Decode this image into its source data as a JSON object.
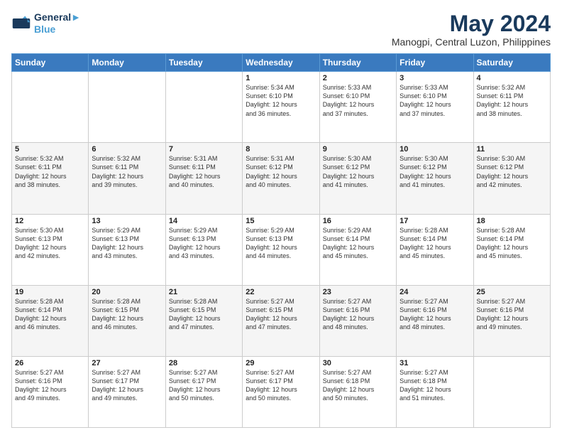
{
  "logo": {
    "line1": "General",
    "line2": "Blue"
  },
  "title": "May 2024",
  "subtitle": "Manogpi, Central Luzon, Philippines",
  "days_header": [
    "Sunday",
    "Monday",
    "Tuesday",
    "Wednesday",
    "Thursday",
    "Friday",
    "Saturday"
  ],
  "weeks": [
    [
      {
        "day": "",
        "text": ""
      },
      {
        "day": "",
        "text": ""
      },
      {
        "day": "",
        "text": ""
      },
      {
        "day": "1",
        "text": "Sunrise: 5:34 AM\nSunset: 6:10 PM\nDaylight: 12 hours\nand 36 minutes."
      },
      {
        "day": "2",
        "text": "Sunrise: 5:33 AM\nSunset: 6:10 PM\nDaylight: 12 hours\nand 37 minutes."
      },
      {
        "day": "3",
        "text": "Sunrise: 5:33 AM\nSunset: 6:10 PM\nDaylight: 12 hours\nand 37 minutes."
      },
      {
        "day": "4",
        "text": "Sunrise: 5:32 AM\nSunset: 6:11 PM\nDaylight: 12 hours\nand 38 minutes."
      }
    ],
    [
      {
        "day": "5",
        "text": "Sunrise: 5:32 AM\nSunset: 6:11 PM\nDaylight: 12 hours\nand 38 minutes."
      },
      {
        "day": "6",
        "text": "Sunrise: 5:32 AM\nSunset: 6:11 PM\nDaylight: 12 hours\nand 39 minutes."
      },
      {
        "day": "7",
        "text": "Sunrise: 5:31 AM\nSunset: 6:11 PM\nDaylight: 12 hours\nand 40 minutes."
      },
      {
        "day": "8",
        "text": "Sunrise: 5:31 AM\nSunset: 6:12 PM\nDaylight: 12 hours\nand 40 minutes."
      },
      {
        "day": "9",
        "text": "Sunrise: 5:30 AM\nSunset: 6:12 PM\nDaylight: 12 hours\nand 41 minutes."
      },
      {
        "day": "10",
        "text": "Sunrise: 5:30 AM\nSunset: 6:12 PM\nDaylight: 12 hours\nand 41 minutes."
      },
      {
        "day": "11",
        "text": "Sunrise: 5:30 AM\nSunset: 6:12 PM\nDaylight: 12 hours\nand 42 minutes."
      }
    ],
    [
      {
        "day": "12",
        "text": "Sunrise: 5:30 AM\nSunset: 6:13 PM\nDaylight: 12 hours\nand 42 minutes."
      },
      {
        "day": "13",
        "text": "Sunrise: 5:29 AM\nSunset: 6:13 PM\nDaylight: 12 hours\nand 43 minutes."
      },
      {
        "day": "14",
        "text": "Sunrise: 5:29 AM\nSunset: 6:13 PM\nDaylight: 12 hours\nand 43 minutes."
      },
      {
        "day": "15",
        "text": "Sunrise: 5:29 AM\nSunset: 6:13 PM\nDaylight: 12 hours\nand 44 minutes."
      },
      {
        "day": "16",
        "text": "Sunrise: 5:29 AM\nSunset: 6:14 PM\nDaylight: 12 hours\nand 45 minutes."
      },
      {
        "day": "17",
        "text": "Sunrise: 5:28 AM\nSunset: 6:14 PM\nDaylight: 12 hours\nand 45 minutes."
      },
      {
        "day": "18",
        "text": "Sunrise: 5:28 AM\nSunset: 6:14 PM\nDaylight: 12 hours\nand 45 minutes."
      }
    ],
    [
      {
        "day": "19",
        "text": "Sunrise: 5:28 AM\nSunset: 6:14 PM\nDaylight: 12 hours\nand 46 minutes."
      },
      {
        "day": "20",
        "text": "Sunrise: 5:28 AM\nSunset: 6:15 PM\nDaylight: 12 hours\nand 46 minutes."
      },
      {
        "day": "21",
        "text": "Sunrise: 5:28 AM\nSunset: 6:15 PM\nDaylight: 12 hours\nand 47 minutes."
      },
      {
        "day": "22",
        "text": "Sunrise: 5:27 AM\nSunset: 6:15 PM\nDaylight: 12 hours\nand 47 minutes."
      },
      {
        "day": "23",
        "text": "Sunrise: 5:27 AM\nSunset: 6:16 PM\nDaylight: 12 hours\nand 48 minutes."
      },
      {
        "day": "24",
        "text": "Sunrise: 5:27 AM\nSunset: 6:16 PM\nDaylight: 12 hours\nand 48 minutes."
      },
      {
        "day": "25",
        "text": "Sunrise: 5:27 AM\nSunset: 6:16 PM\nDaylight: 12 hours\nand 49 minutes."
      }
    ],
    [
      {
        "day": "26",
        "text": "Sunrise: 5:27 AM\nSunset: 6:16 PM\nDaylight: 12 hours\nand 49 minutes."
      },
      {
        "day": "27",
        "text": "Sunrise: 5:27 AM\nSunset: 6:17 PM\nDaylight: 12 hours\nand 49 minutes."
      },
      {
        "day": "28",
        "text": "Sunrise: 5:27 AM\nSunset: 6:17 PM\nDaylight: 12 hours\nand 50 minutes."
      },
      {
        "day": "29",
        "text": "Sunrise: 5:27 AM\nSunset: 6:17 PM\nDaylight: 12 hours\nand 50 minutes."
      },
      {
        "day": "30",
        "text": "Sunrise: 5:27 AM\nSunset: 6:18 PM\nDaylight: 12 hours\nand 50 minutes."
      },
      {
        "day": "31",
        "text": "Sunrise: 5:27 AM\nSunset: 6:18 PM\nDaylight: 12 hours\nand 51 minutes."
      },
      {
        "day": "",
        "text": ""
      }
    ]
  ]
}
